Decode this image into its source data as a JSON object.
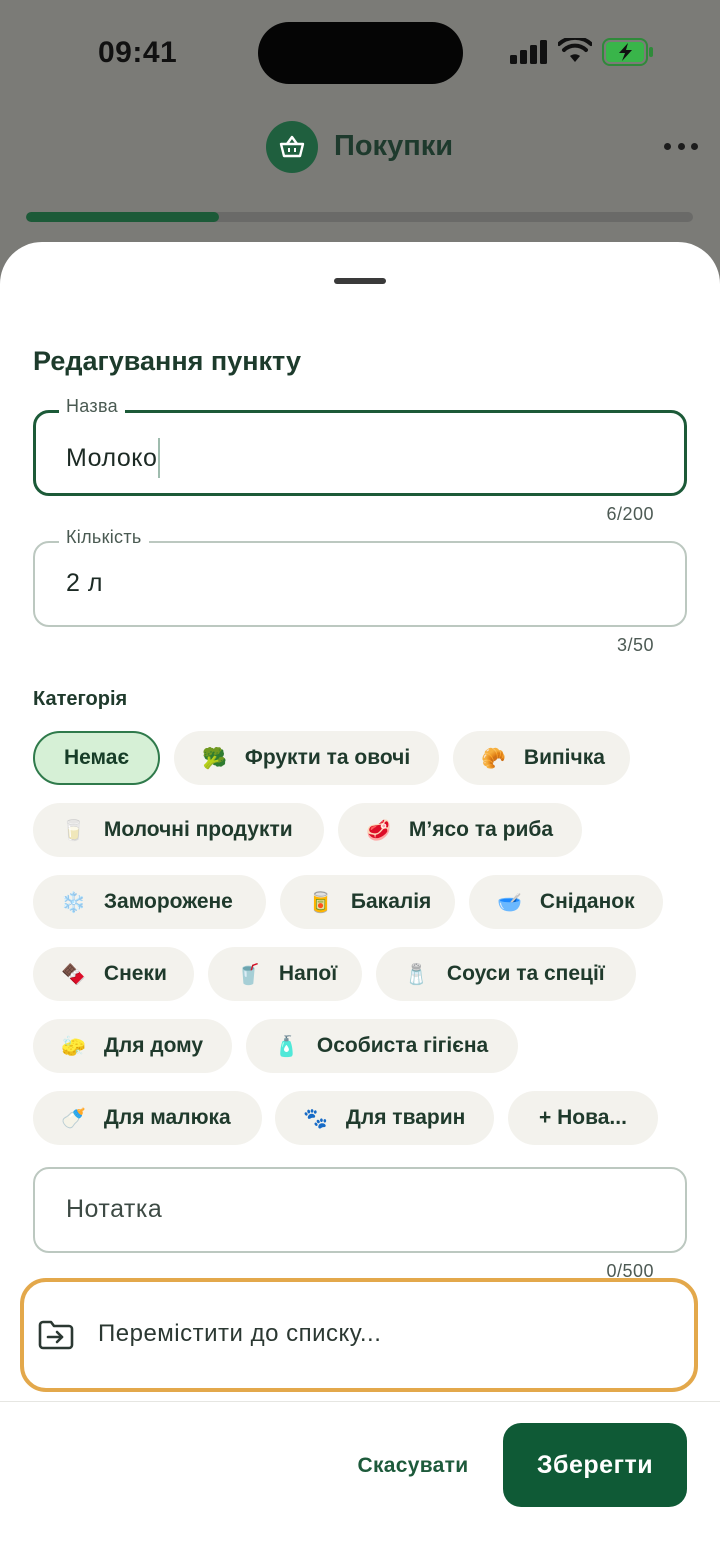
{
  "status_bar": {
    "time": "09:41"
  },
  "app": {
    "title": "Покупки",
    "progress_fraction": 0.29
  },
  "sheet": {
    "title": "Редагування пункту",
    "name_field": {
      "label": "Назва",
      "value": "Молоко",
      "counter": "6/200"
    },
    "quantity_field": {
      "label": "Кількість",
      "value": "2 л",
      "counter": "3/50"
    },
    "category_label": "Категорія",
    "categories": [
      {
        "label": "Немає",
        "emoji": "",
        "selected": true
      },
      {
        "label": "Фрукти та овочі",
        "emoji": "🥦"
      },
      {
        "label": "Випічка",
        "emoji": "🥐"
      },
      {
        "label": "Молочні продукти",
        "emoji": "🥛"
      },
      {
        "label": "М’ясо та риба",
        "emoji": "🥩"
      },
      {
        "label": "Заморожене",
        "emoji": "❄️"
      },
      {
        "label": "Бакалія",
        "emoji": "🥫"
      },
      {
        "label": "Сніданок",
        "emoji": "🥣"
      },
      {
        "label": "Снеки",
        "emoji": "🍫"
      },
      {
        "label": "Напої",
        "emoji": "🥤"
      },
      {
        "label": "Соуси та спеції",
        "emoji": "🧂"
      },
      {
        "label": "Для дому",
        "emoji": "🧽"
      },
      {
        "label": "Особиста гігієна",
        "emoji": "🧴"
      },
      {
        "label": "Для малюка",
        "emoji": "🍼"
      },
      {
        "label": "Для тварин",
        "emoji": "🐾"
      },
      {
        "label": "+ Нова...",
        "emoji": ""
      }
    ],
    "note_field": {
      "placeholder": "Нотатка",
      "counter": "0/500"
    },
    "move_to_list": "Перемістити до списку...",
    "cancel_label": "Скасувати",
    "save_label": "Зберегти"
  },
  "colors": {
    "accent": "#0f5a36",
    "highlight_border": "#e3a84b",
    "chip_selected_bg": "#d6f0d6"
  }
}
